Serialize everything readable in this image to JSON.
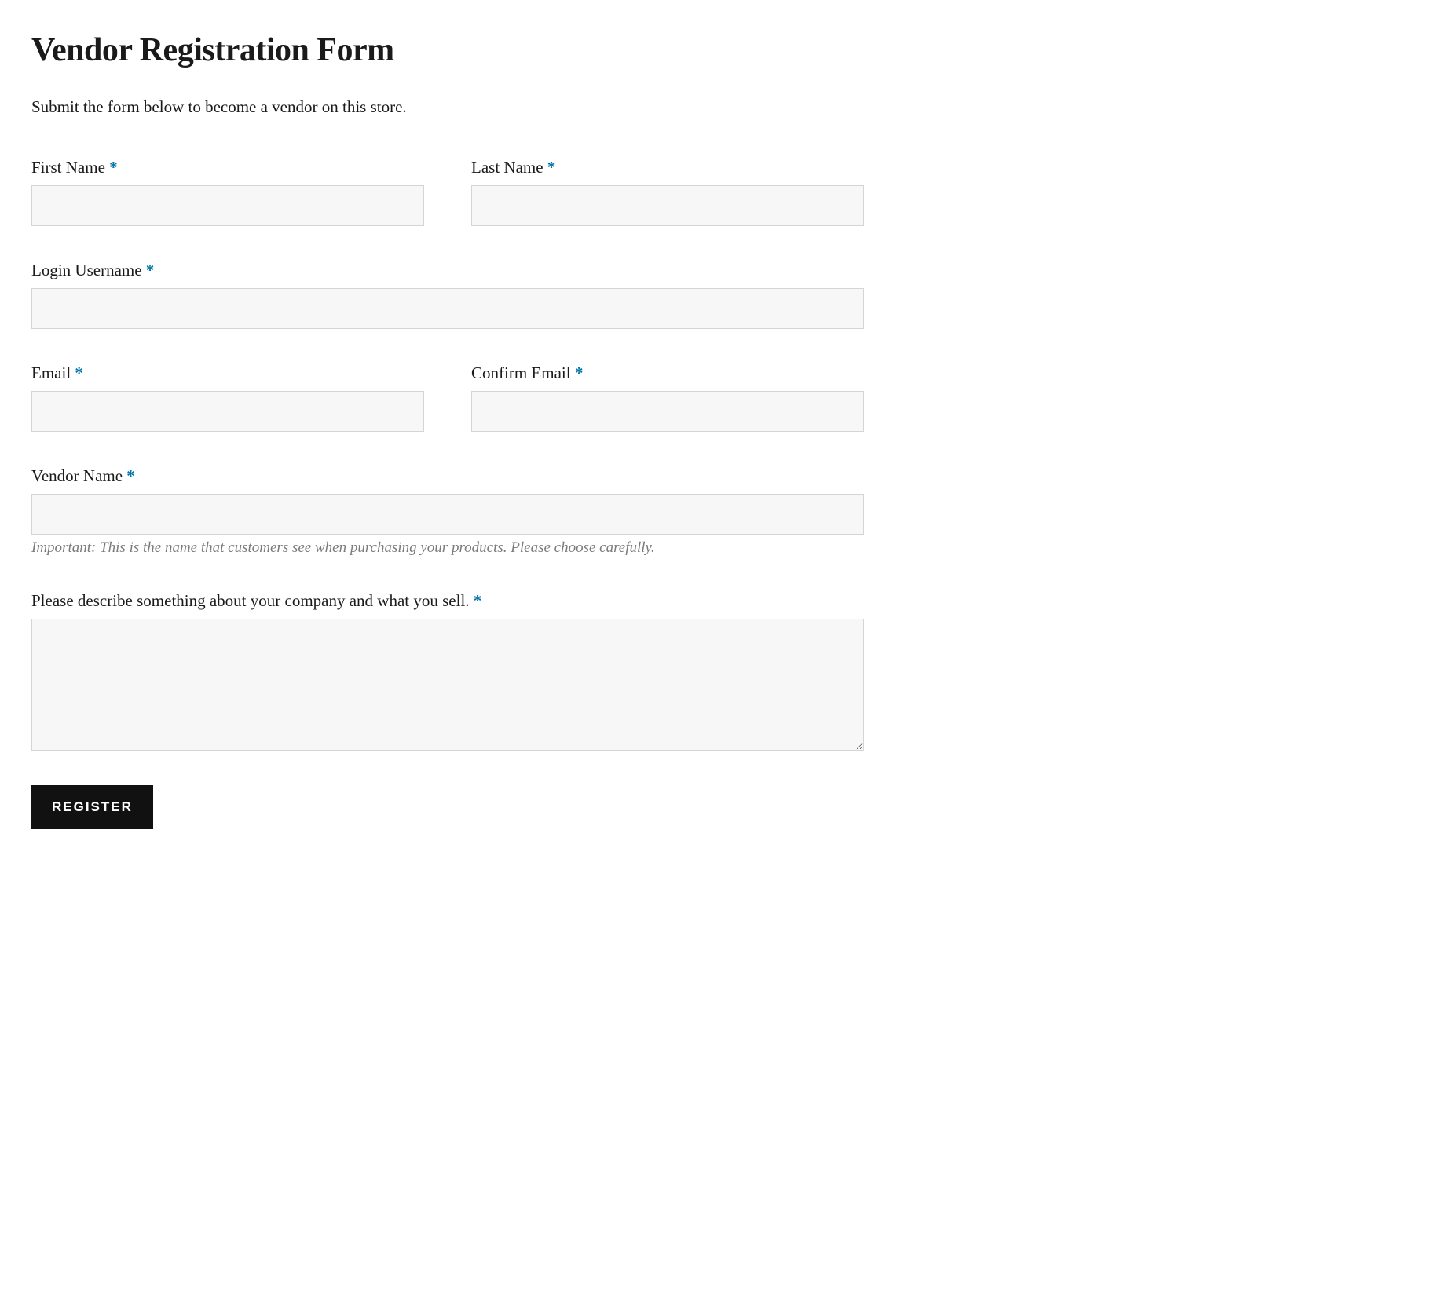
{
  "page": {
    "title": "Vendor Registration Form",
    "intro": "Submit the form below to become a vendor on this store."
  },
  "form": {
    "required_mark": "*",
    "fields": {
      "first_name": {
        "label": "First Name ",
        "value": ""
      },
      "last_name": {
        "label": "Last Name ",
        "value": ""
      },
      "login_username": {
        "label": "Login Username ",
        "value": ""
      },
      "email": {
        "label": "Email ",
        "value": ""
      },
      "confirm_email": {
        "label": "Confirm Email ",
        "value": ""
      },
      "vendor_name": {
        "label": "Vendor Name ",
        "value": "",
        "helper": "Important: This is the name that customers see when purchasing your products. Please choose carefully."
      },
      "description": {
        "label": "Please describe something about your company and what you sell. ",
        "value": ""
      }
    },
    "submit_label": "REGISTER"
  }
}
